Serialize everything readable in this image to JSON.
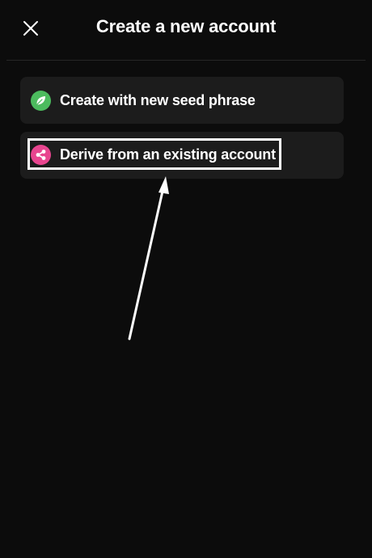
{
  "header": {
    "title": "Create a new account",
    "close_icon": "close-icon"
  },
  "options": [
    {
      "label": "Create with new seed phrase",
      "icon": "leaf-icon",
      "icon_color": "#4cbb5e"
    },
    {
      "label": "Derive from an existing account",
      "icon": "share-icon",
      "icon_color": "#e8458f"
    }
  ],
  "colors": {
    "background": "#0c0c0c",
    "card": "#1c1c1c",
    "annotation": "#ffffff"
  }
}
